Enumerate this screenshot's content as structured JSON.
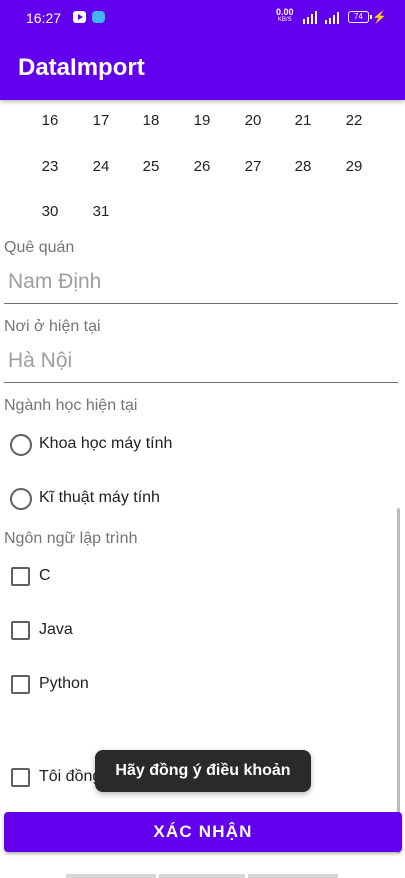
{
  "status_bar": {
    "time": "16:27",
    "speed_value": "0.00",
    "speed_unit": "KB/S",
    "battery": "74",
    "icons": [
      "youtube-icon",
      "messenger-icon",
      "signal-icon",
      "battery-icon",
      "charging-icon"
    ]
  },
  "app_bar": {
    "title": "DataImport"
  },
  "calendar": {
    "rows": [
      [
        "16",
        "17",
        "18",
        "19",
        "20",
        "21",
        "22"
      ],
      [
        "23",
        "24",
        "25",
        "26",
        "27",
        "28",
        "29"
      ],
      [
        "30",
        "31"
      ]
    ]
  },
  "hometown": {
    "label": "Quê quán",
    "placeholder": "Nam Định"
  },
  "current_residence": {
    "label": "Nơi ở hiện tại",
    "placeholder": "Hà Nội"
  },
  "major": {
    "label": "Ngành học hiện tại",
    "options": [
      "Khoa học máy tính",
      "Kĩ thuật máy tính"
    ]
  },
  "languages": {
    "label": "Ngôn ngữ lập trình",
    "options": [
      "C",
      "Java",
      "Python"
    ]
  },
  "terms": {
    "label": "Tôi đồng"
  },
  "toast": {
    "text": "Hãy đồng ý điều khoản"
  },
  "submit": {
    "label": "XÁC NHẬN"
  },
  "colors": {
    "primary": "#6200ee",
    "toast_bg": "#2a2a2a"
  }
}
